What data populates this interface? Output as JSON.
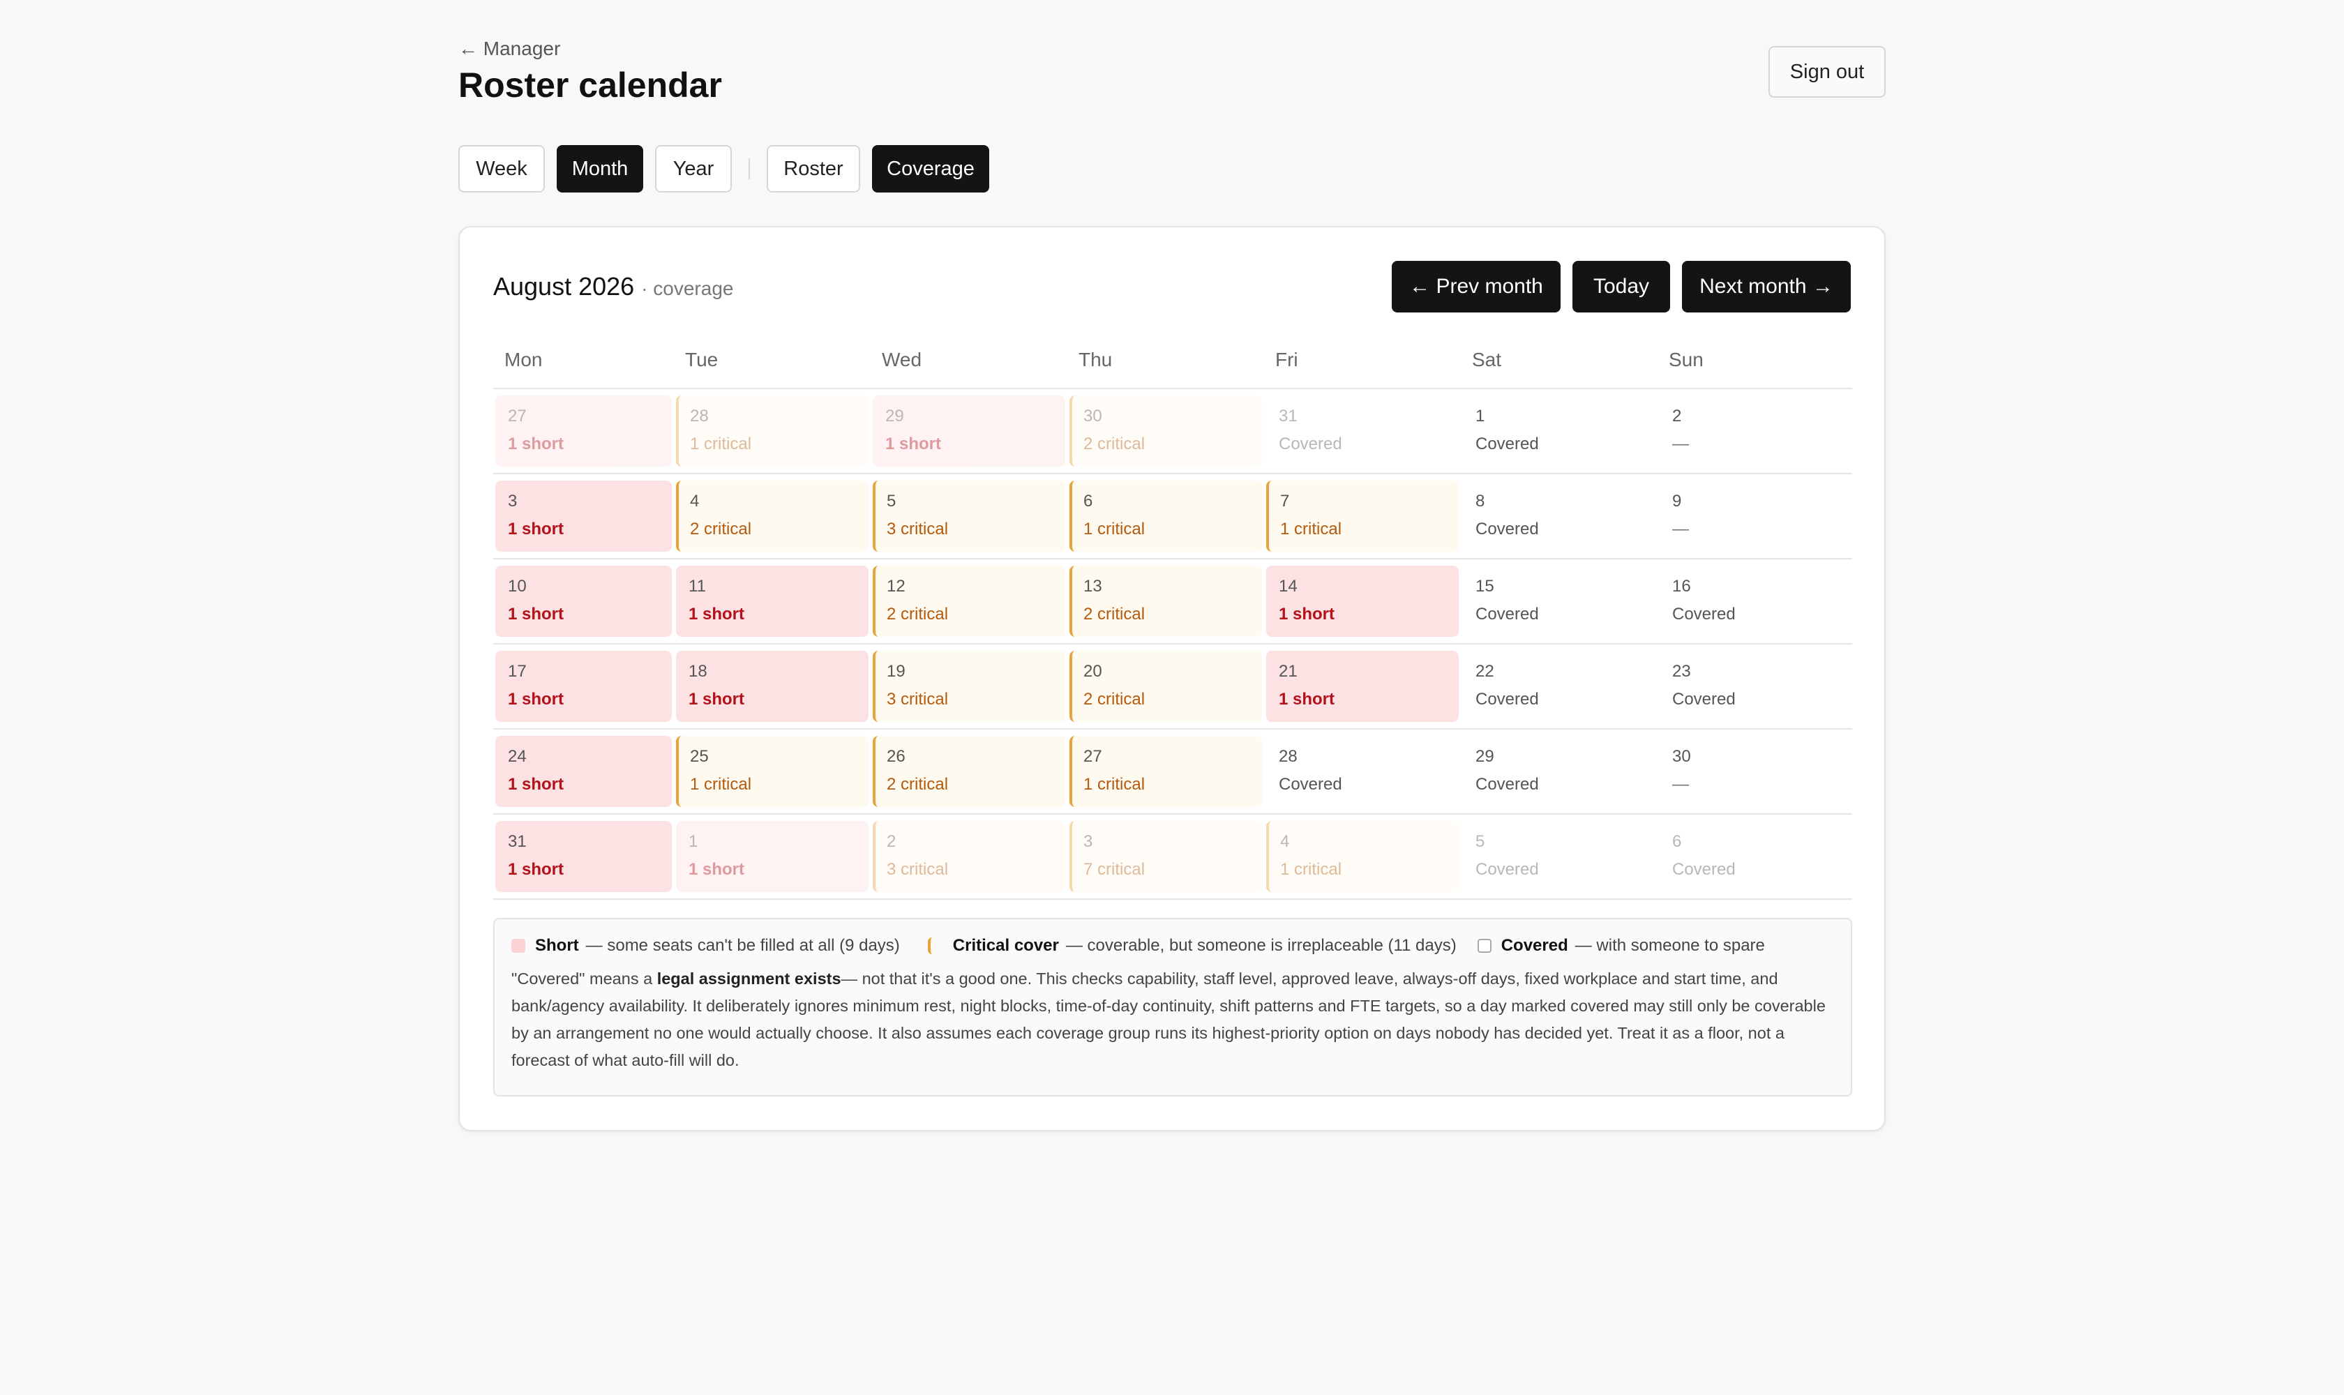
{
  "header": {
    "back_link": "← Manager",
    "title": "Roster calendar",
    "sign_out": "Sign out"
  },
  "tabs": {
    "view": [
      {
        "label": "Week",
        "active": false
      },
      {
        "label": "Month",
        "active": true
      },
      {
        "label": "Year",
        "active": false
      }
    ],
    "mode": [
      {
        "label": "Roster",
        "active": false
      },
      {
        "label": "Coverage",
        "active": true
      }
    ]
  },
  "calendar": {
    "month": "August 2026",
    "subtitle": "· coverage",
    "prev_label": "← Prev month",
    "today_label": "Today",
    "next_label": "Next month →",
    "weekdays": [
      "Mon",
      "Tue",
      "Wed",
      "Thu",
      "Fri",
      "Sat",
      "Sun"
    ],
    "weeks": [
      [
        {
          "day": "27",
          "status": "1 short",
          "kind": "short",
          "outside": true
        },
        {
          "day": "28",
          "status": "1 critical",
          "kind": "critical",
          "outside": true
        },
        {
          "day": "29",
          "status": "1 short",
          "kind": "short",
          "outside": true
        },
        {
          "day": "30",
          "status": "2 critical",
          "kind": "critical",
          "outside": true
        },
        {
          "day": "31",
          "status": "Covered",
          "kind": "covered",
          "outside": true
        },
        {
          "day": "1",
          "status": "Covered",
          "kind": "covered",
          "outside": false
        },
        {
          "day": "2",
          "status": "—",
          "kind": "none",
          "outside": false
        }
      ],
      [
        {
          "day": "3",
          "status": "1 short",
          "kind": "short",
          "outside": false
        },
        {
          "day": "4",
          "status": "2 critical",
          "kind": "critical",
          "outside": false
        },
        {
          "day": "5",
          "status": "3 critical",
          "kind": "critical",
          "outside": false
        },
        {
          "day": "6",
          "status": "1 critical",
          "kind": "critical",
          "outside": false
        },
        {
          "day": "7",
          "status": "1 critical",
          "kind": "critical",
          "outside": false
        },
        {
          "day": "8",
          "status": "Covered",
          "kind": "covered",
          "outside": false
        },
        {
          "day": "9",
          "status": "—",
          "kind": "none",
          "outside": false
        }
      ],
      [
        {
          "day": "10",
          "status": "1 short",
          "kind": "short",
          "outside": false
        },
        {
          "day": "11",
          "status": "1 short",
          "kind": "short",
          "outside": false
        },
        {
          "day": "12",
          "status": "2 critical",
          "kind": "critical",
          "outside": false
        },
        {
          "day": "13",
          "status": "2 critical",
          "kind": "critical",
          "outside": false
        },
        {
          "day": "14",
          "status": "1 short",
          "kind": "short",
          "outside": false
        },
        {
          "day": "15",
          "status": "Covered",
          "kind": "covered",
          "outside": false
        },
        {
          "day": "16",
          "status": "Covered",
          "kind": "covered",
          "outside": false
        }
      ],
      [
        {
          "day": "17",
          "status": "1 short",
          "kind": "short",
          "outside": false
        },
        {
          "day": "18",
          "status": "1 short",
          "kind": "short",
          "outside": false
        },
        {
          "day": "19",
          "status": "3 critical",
          "kind": "critical",
          "outside": false
        },
        {
          "day": "20",
          "status": "2 critical",
          "kind": "critical",
          "outside": false
        },
        {
          "day": "21",
          "status": "1 short",
          "kind": "short",
          "outside": false
        },
        {
          "day": "22",
          "status": "Covered",
          "kind": "covered",
          "outside": false
        },
        {
          "day": "23",
          "status": "Covered",
          "kind": "covered",
          "outside": false
        }
      ],
      [
        {
          "day": "24",
          "status": "1 short",
          "kind": "short",
          "outside": false
        },
        {
          "day": "25",
          "status": "1 critical",
          "kind": "critical",
          "outside": false
        },
        {
          "day": "26",
          "status": "2 critical",
          "kind": "critical",
          "outside": false
        },
        {
          "day": "27",
          "status": "1 critical",
          "kind": "critical",
          "outside": false
        },
        {
          "day": "28",
          "status": "Covered",
          "kind": "covered",
          "outside": false
        },
        {
          "day": "29",
          "status": "Covered",
          "kind": "covered",
          "outside": false
        },
        {
          "day": "30",
          "status": "—",
          "kind": "none",
          "outside": false
        }
      ],
      [
        {
          "day": "31",
          "status": "1 short",
          "kind": "short",
          "outside": false
        },
        {
          "day": "1",
          "status": "1 short",
          "kind": "short",
          "outside": true
        },
        {
          "day": "2",
          "status": "3 critical",
          "kind": "critical",
          "outside": true
        },
        {
          "day": "3",
          "status": "7 critical",
          "kind": "critical",
          "outside": true
        },
        {
          "day": "4",
          "status": "1 critical",
          "kind": "critical",
          "outside": true
        },
        {
          "day": "5",
          "status": "Covered",
          "kind": "covered",
          "outside": true
        },
        {
          "day": "6",
          "status": "Covered",
          "kind": "covered",
          "outside": true
        }
      ]
    ]
  },
  "legend": {
    "short_label": "Short",
    "short_text": "— some seats can't be filled at all (9 days)",
    "critical_label": "Critical cover",
    "critical_text": "— coverable, but someone is irreplaceable (11 days)",
    "covered_label": "Covered",
    "covered_text": "— with someone to spare",
    "note_prefix": "\"Covered\" means a ",
    "note_bold": "legal assignment exists",
    "note_rest": "— not that it's a good one. This checks capability, staff level, approved leave, always-off days, fixed workplace and start time, and bank/agency availability. It deliberately ignores minimum rest, night blocks, time-of-day continuity, shift patterns and FTE targets, so a day marked covered may still only be coverable by an arrangement no one would actually choose. It also assumes each coverage group runs its highest-priority option on days nobody has decided yet. Treat it as a floor, not a forecast of what auto-fill will do."
  },
  "colors": {
    "short_bg": "#fde2e3",
    "short_text": "#b3121b",
    "critical_border": "#e8a33c",
    "critical_text": "#b35a0e",
    "button_dark": "#141414"
  }
}
